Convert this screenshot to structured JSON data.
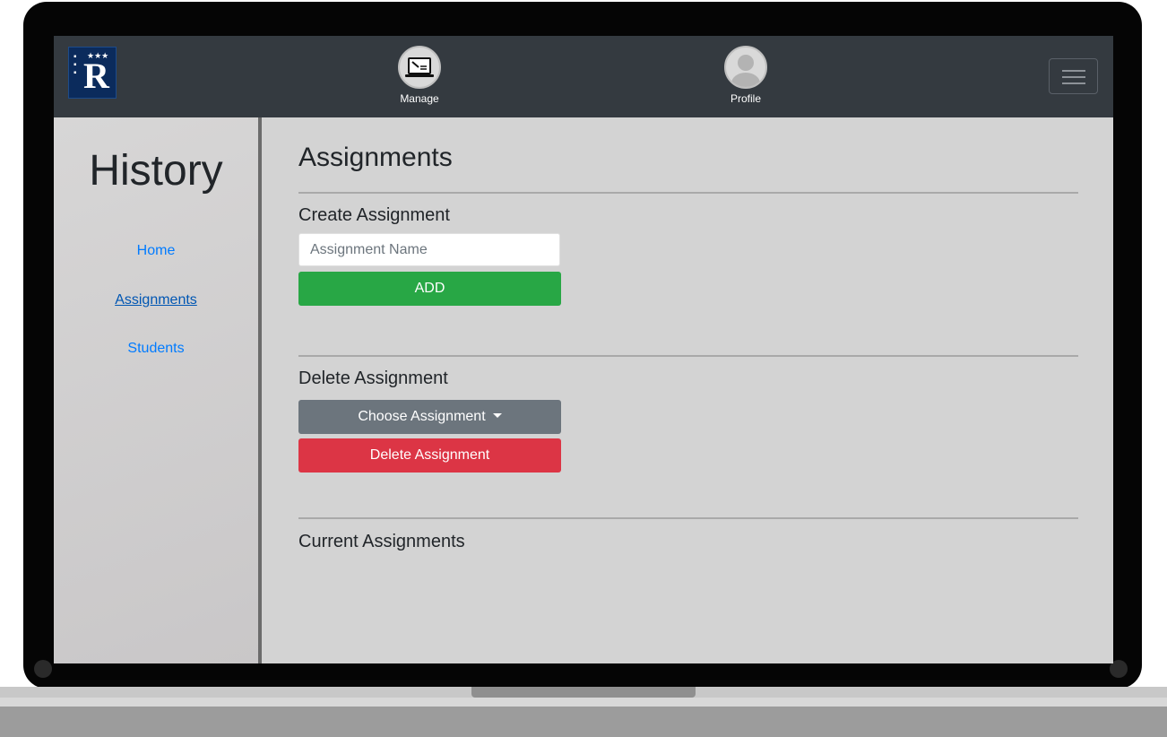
{
  "navbar": {
    "logo_letter": "R",
    "manage_label": "Manage",
    "profile_label": "Profile"
  },
  "sidebar": {
    "title": "History",
    "links": [
      {
        "label": "Home"
      },
      {
        "label": "Assignments"
      },
      {
        "label": "Students"
      }
    ]
  },
  "main": {
    "title": "Assignments",
    "create": {
      "heading": "Create Assignment",
      "input_placeholder": "Assignment Name",
      "add_label": "ADD"
    },
    "delete": {
      "heading": "Delete Assignment",
      "choose_label": "Choose Assignment",
      "delete_label": "Delete Assignment"
    },
    "current": {
      "heading": "Current Assignments"
    }
  },
  "colors": {
    "navbar": "#343a40",
    "content_bg": "#d3d3d3",
    "link": "#007bff",
    "success": "#28a745",
    "secondary": "#6c757d",
    "danger": "#dc3545"
  },
  "icons": {
    "manage": "laptop-icon",
    "profile": "avatar-icon",
    "menu": "hamburger-menu-icon"
  }
}
